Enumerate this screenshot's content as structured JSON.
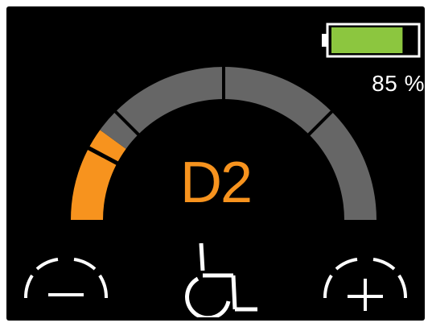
{
  "battery": {
    "level": 0.85,
    "percent_label": "85 %",
    "fill_color": "#8cc63f",
    "icon": "battery-icon"
  },
  "speed_gauge": {
    "segments": 4,
    "level": 0.2,
    "active_color": "#f7931e",
    "inactive_color": "#666666"
  },
  "drive_mode": {
    "label": "D2",
    "color": "#f7931e"
  },
  "controls": {
    "decrease": {
      "icon": "minus-icon"
    },
    "mode": {
      "icon": "wheelchair-icon"
    },
    "increase": {
      "icon": "plus-icon"
    }
  }
}
